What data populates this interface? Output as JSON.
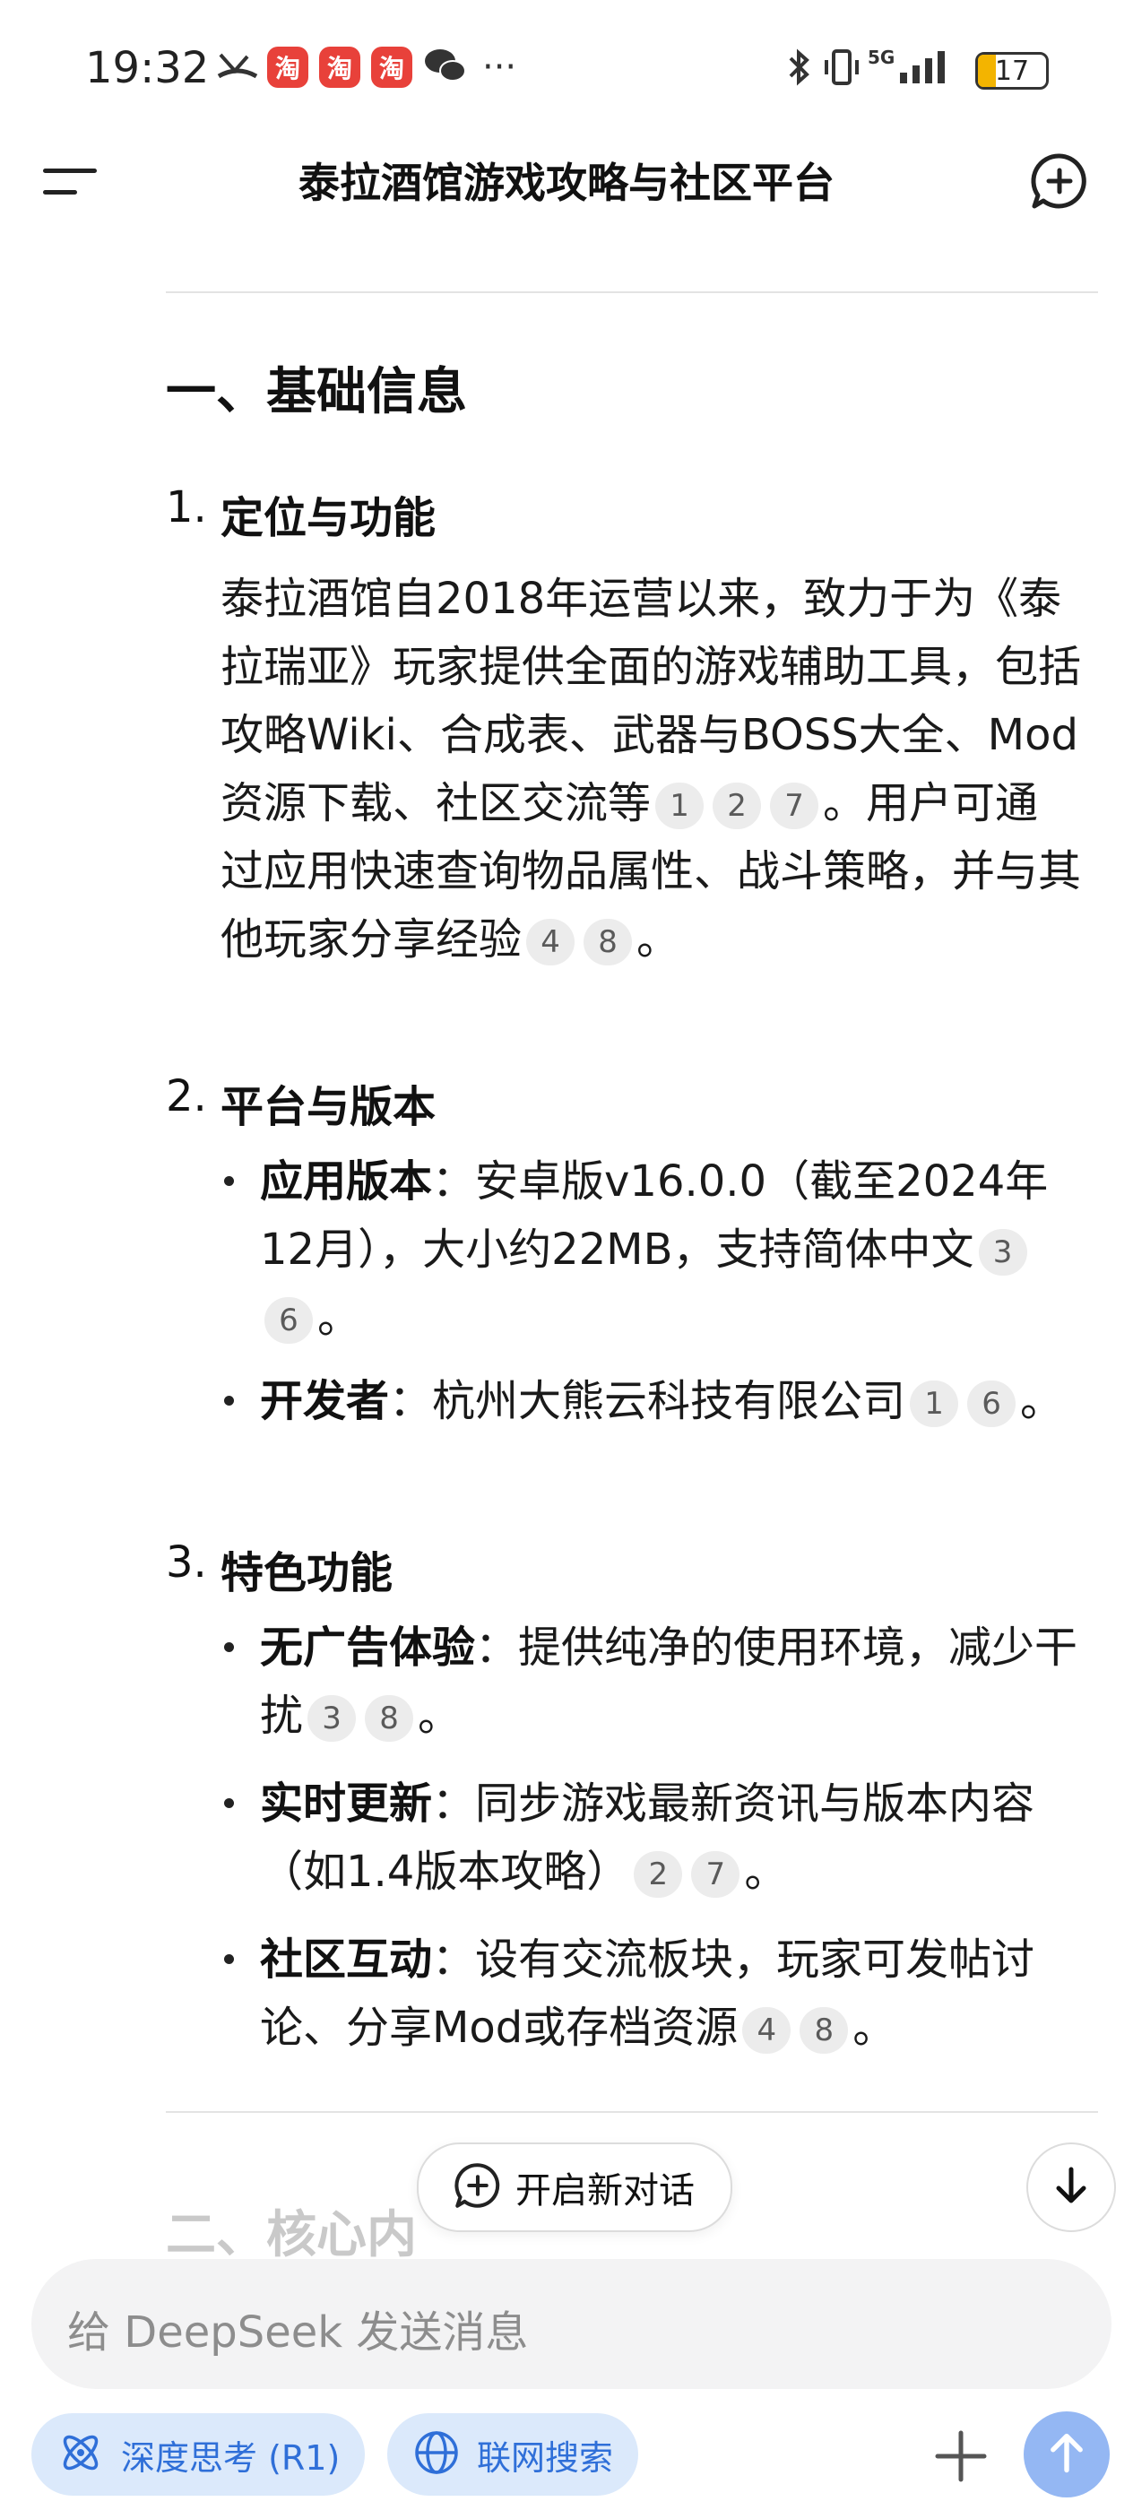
{
  "status_bar": {
    "time": "19:32",
    "taobao_label": "淘",
    "battery_level": "17",
    "network": "5G",
    "overflow": "···"
  },
  "header": {
    "title": "泰拉酒馆游戏攻略与社区平台"
  },
  "content": {
    "section_title": "一、基础信息",
    "items": [
      {
        "num": "1.",
        "title": "定位与功能",
        "para_part1": "泰拉酒馆自2018年运营以来，致力于为《泰拉瑞亚》玩家提供全面的游戏辅助工具，包括攻略Wiki、合成表、武器与BOSS大全、Mod资源下载、社区交流等",
        "cites1": [
          "1",
          "2",
          "7"
        ],
        "para_part2": "。用户可通过应用快速查询物品属性、战斗策略，并与其他玩家分享经验",
        "cites2": [
          "4",
          "8"
        ],
        "para_end": "。"
      },
      {
        "num": "2.",
        "title": "平台与版本",
        "bullets": [
          {
            "label": "应用版本",
            "text": "：安卓版v16.0.0（截至2024年12月），大小约22MB，支持简体中文",
            "cites": [
              "3",
              "6"
            ],
            "end": "。"
          },
          {
            "label": "开发者",
            "text": "：杭州大熊云科技有限公司",
            "cites": [
              "1",
              "6"
            ],
            "end": "。"
          }
        ]
      },
      {
        "num": "3.",
        "title": "特色功能",
        "bullets": [
          {
            "label": "无广告体验",
            "text": "：提供纯净的使用环境，减少干扰",
            "cites": [
              "3",
              "8"
            ],
            "end": "。"
          },
          {
            "label": "实时更新",
            "text": "：同步游戏最新资讯与版本内容（如1.4版本攻略）",
            "cites": [
              "2",
              "7"
            ],
            "end": "。"
          },
          {
            "label": "社区互动",
            "text": "：设有交流板块，玩家可发帖讨论、分享Mod或存档资源",
            "cites": [
              "4",
              "8"
            ],
            "end": "。"
          }
        ]
      }
    ],
    "next_section_partial": "二、核心内"
  },
  "floating": {
    "new_chat_label": "开启新对话"
  },
  "composer": {
    "placeholder": "给 DeepSeek 发送消息",
    "chip_deepthink": "深度思考 (R1)",
    "chip_search": "联网搜索"
  },
  "colors": {
    "accent_blue": "#2f6fd8",
    "chip_bg": "#dbe9fb",
    "send_bg": "#94b7f3",
    "cite_bg": "#ececec"
  }
}
